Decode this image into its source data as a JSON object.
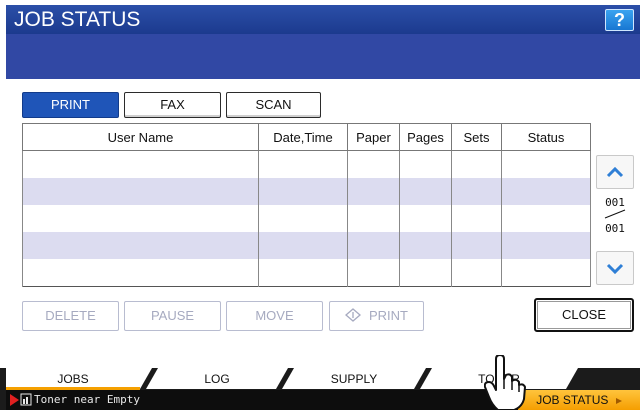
{
  "window": {
    "title": "JOB STATUS",
    "help_label": "?"
  },
  "tabs": [
    {
      "label": "PRINT",
      "active": true
    },
    {
      "label": "FAX",
      "active": false
    },
    {
      "label": "SCAN",
      "active": false
    }
  ],
  "table": {
    "columns": [
      "User Name",
      "Date,Time",
      "Paper",
      "Pages",
      "Sets",
      "Status"
    ],
    "rows": [
      [],
      [],
      [],
      [],
      []
    ]
  },
  "pager": {
    "current": "001",
    "total": "001"
  },
  "actions": {
    "delete_label": "DELETE",
    "pause_label": "PAUSE",
    "move_label": "MOVE",
    "print_label": "PRINT",
    "close_label": "CLOSE"
  },
  "bottom_tabs": [
    {
      "label": "JOBS",
      "active": true
    },
    {
      "label": "LOG",
      "active": false
    },
    {
      "label": "SUPPLY",
      "active": false
    },
    {
      "label": "TONER",
      "active": false
    }
  ],
  "status": {
    "message": "Toner near Empty",
    "job_status_label": "JOB STATUS"
  },
  "colors": {
    "title_bg": "#1f3d90",
    "accent": "#1f55b8",
    "active_tab_stripe": "#f5a000",
    "row_shade": "#dcdcf0"
  }
}
